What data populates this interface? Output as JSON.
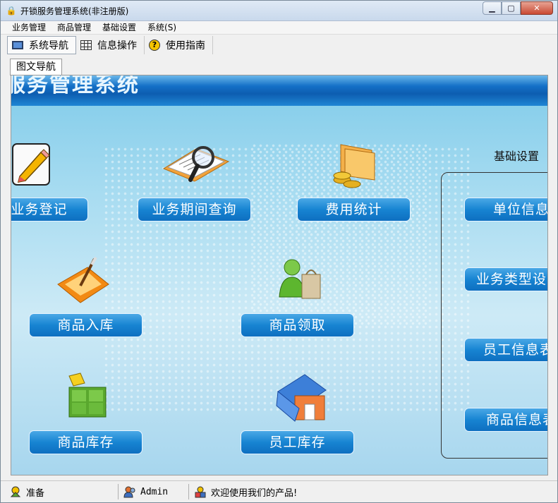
{
  "window": {
    "title": "开锁服务管理系统(非注册版)"
  },
  "menu": [
    "业务管理",
    "商品管理",
    "基础设置",
    "系统(S)"
  ],
  "toolbar": {
    "nav": "系统导航",
    "info": "信息操作",
    "guide": "使用指南"
  },
  "tab": {
    "label": "图文导航"
  },
  "banner": {
    "text": "服务管理系统"
  },
  "nav": {
    "register": "业务登记",
    "period_query": "业务期间查询",
    "fee_stats": "费用统计",
    "stock_in": "商品入库",
    "receive": "商品领取",
    "inventory": "商品库存",
    "staff_inventory": "员工库存"
  },
  "settings": {
    "title": "基础设置",
    "unit_info": "单位信息",
    "business_type": "业务类型设",
    "staff_info": "员工信息表",
    "goods_info": "商品信息表"
  },
  "status": {
    "ready": "准备",
    "user": "Admin",
    "welcome": "欢迎使用我们的产品!"
  },
  "colors": {
    "button": "#1784d2",
    "banner": "#0d5db0",
    "background": "#a8dcf1"
  }
}
